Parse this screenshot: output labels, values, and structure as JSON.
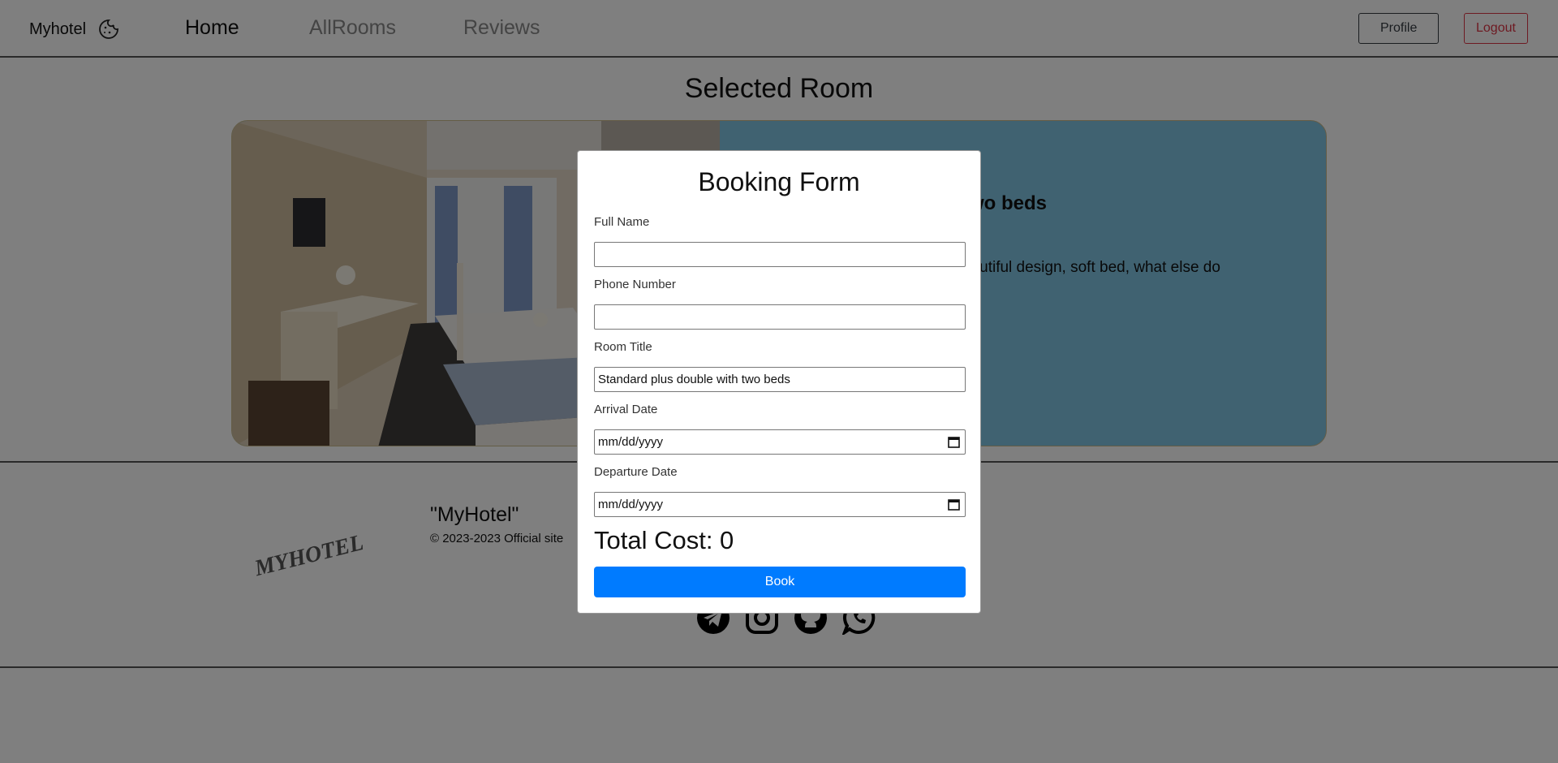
{
  "nav": {
    "brand": "Myhotel",
    "links": [
      "Home",
      "AllRooms",
      "Reviews"
    ],
    "profile_label": "Profile",
    "logout_label": "Logout"
  },
  "main": {
    "title": "Selected Room",
    "room_name": "two beds",
    "room_description": "eautiful design, soft bed, what else do"
  },
  "footer": {
    "logo_text": "MYHOTEL",
    "name": "\"MyHotel\"",
    "copyright": "© 2023-2023 Official site",
    "social_icons": [
      "telegram-icon",
      "instagram-icon",
      "github-icon",
      "whatsapp-icon"
    ]
  },
  "modal": {
    "title": "Booking Form",
    "fields": [
      {
        "label": "Full Name",
        "value": ""
      },
      {
        "label": "Phone Number",
        "value": ""
      },
      {
        "label": "Room Title",
        "value": "Standard plus double with two beds"
      },
      {
        "label": "Arrival Date",
        "value": "mm/dd/yyyy"
      },
      {
        "label": "Departure Date",
        "value": "mm/dd/yyyy"
      }
    ],
    "total_label": "Total Cost: 0",
    "book_label": "Book"
  },
  "colors": {
    "accent": "#007bff",
    "danger": "#dc3545",
    "card_background": "#80c4e3"
  }
}
